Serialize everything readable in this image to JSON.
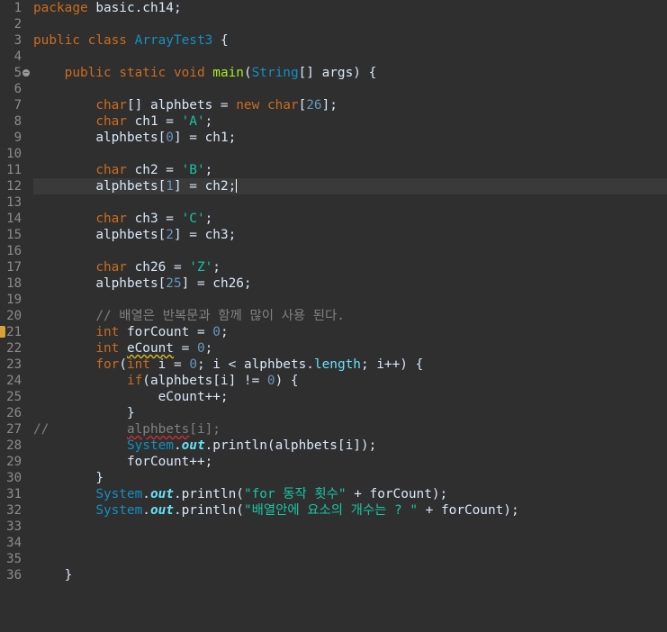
{
  "editor": {
    "line_numbers": [
      "1",
      "2",
      "3",
      "4",
      "5",
      "6",
      "7",
      "8",
      "9",
      "10",
      "11",
      "12",
      "13",
      "14",
      "15",
      "16",
      "17",
      "18",
      "19",
      "20",
      "21",
      "22",
      "23",
      "24",
      "25",
      "26",
      "27",
      "28",
      "29",
      "30",
      "31",
      "32",
      "33",
      "34",
      "35",
      "36"
    ],
    "code": {
      "l1_a": "package",
      "l1_b": " basic.ch14;",
      "l3_a": "public",
      "l3_b": " ",
      "l3_c": "class",
      "l3_d": " ",
      "l3_e": "ArrayTest3",
      "l3_f": " {",
      "l5_a": "public",
      "l5_b": "static",
      "l5_c": "void",
      "l5_d": "main",
      "l5_e": "String",
      "l5_f": "args",
      "l7_a": "char",
      "l7_b": "[] alphbets = ",
      "l7_c": "new",
      "l7_d": "char",
      "l7_e": "26",
      "l8_a": "char",
      "l8_b": " ch1 = ",
      "l8_c": "'A'",
      "l9_a": "alphbets[",
      "l9_b": "0",
      "l9_c": "] = ch1;",
      "l11_a": "char",
      "l11_b": " ch2 = ",
      "l11_c": "'B'",
      "l12_a": "alphbets[",
      "l12_b": "1",
      "l12_c": "] = ch2;",
      "l14_a": "char",
      "l14_b": " ch3 = ",
      "l14_c": "'C'",
      "l15_a": "alphbets[",
      "l15_b": "2",
      "l15_c": "] = ch3;",
      "l17_a": "char",
      "l17_b": " ch26 = ",
      "l17_c": "'Z'",
      "l18_a": "alphbets[",
      "l18_b": "25",
      "l18_c": "] = ch26;",
      "l20": "// 배열은 반복문과 함께 많이 사용 된다.",
      "l21_a": "int",
      "l21_b": " forCount = ",
      "l21_c": "0",
      "l22_a": "int",
      "l22_b": "eCount",
      "l22_c": " = ",
      "l22_d": "0",
      "l23_a": "for",
      "l23_b": "(",
      "l23_c": "int",
      "l23_d": " i = ",
      "l23_e": "0",
      "l23_f": "; i < alphbets.",
      "l23_g": "length",
      "l23_h": "; i++) {",
      "l24_a": "if",
      "l24_b": "(alphbets[i] != ",
      "l24_c": "0",
      "l24_d": ") {",
      "l25": "eCount++;",
      "l26": "}",
      "l27_a": "//",
      "l27_b": "alphbets",
      "l27_c": "[i];",
      "l28_a": "System",
      "l28_b": "out",
      "l28_c": ".println(alphbets[i]);",
      "l29": "forCount++;",
      "l30": "}",
      "l31_a": "System",
      "l31_b": "out",
      "l31_c": ".println(",
      "l31_d": "\"for 동작 횟수\"",
      "l31_e": " + forCount);",
      "l32_a": "System",
      "l32_b": "out",
      "l32_c": ".println(",
      "l32_d": "\"배열안에 요소의 개수는 ? \"",
      "l32_e": " + forCount);",
      "l36": "}"
    }
  },
  "colors": {
    "background": "#2f2f2f",
    "keyword": "#cc6c1d",
    "type": "#1290c3",
    "string": "#17c6a3",
    "number": "#6897bb",
    "method": "#a7ec21",
    "field": "#66e1f8",
    "comment": "#808080",
    "text": "#d9e8f7"
  },
  "icons": {
    "fold": "collapse-circle-icon",
    "warning": "warning-marker-icon"
  }
}
